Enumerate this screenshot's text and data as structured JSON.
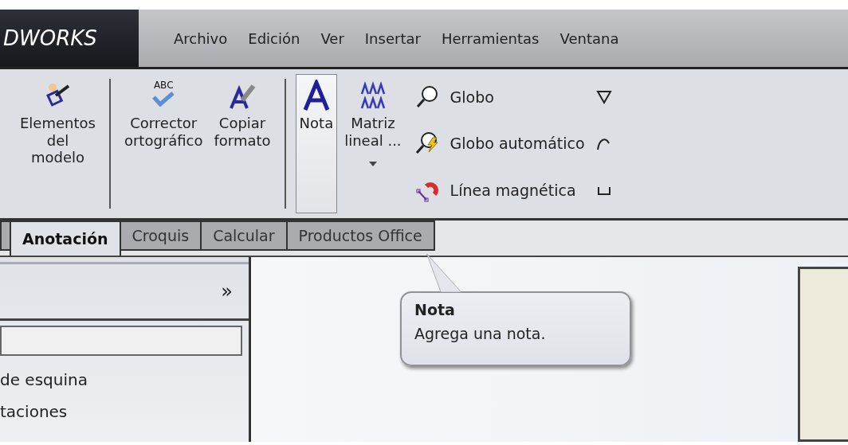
{
  "logo": "DWORKS",
  "menu": [
    "Archivo",
    "Edición",
    "Ver",
    "Insertar",
    "Herramientas",
    "Ventana"
  ],
  "ribbon": {
    "large_buttons": [
      {
        "label": "Elementos\ndel\nmodelo",
        "selected": false
      },
      {
        "label": "Corrector\nortográfico",
        "icon_text": "ABC",
        "selected": false
      },
      {
        "label": "Copiar\nformato",
        "selected": false
      },
      {
        "label": "Nota",
        "selected": true
      },
      {
        "label": "Matriz\nlineal ...",
        "selected": false
      }
    ],
    "small_buttons": [
      "Globo",
      "Globo automático",
      "Línea magnética"
    ]
  },
  "tabs": [
    {
      "selected": false
    },
    {
      "label": "Anotación",
      "selected": true
    },
    {
      "label": "Croquis",
      "selected": false
    },
    {
      "label": "Calcular",
      "selected": false
    },
    {
      "label": "Productos Office",
      "selected": false
    }
  ],
  "panel": {
    "expand": "»",
    "items": [
      "de esquina",
      "taciones"
    ]
  },
  "tooltip": {
    "title": "Nota",
    "text": "Agrega una nota."
  }
}
